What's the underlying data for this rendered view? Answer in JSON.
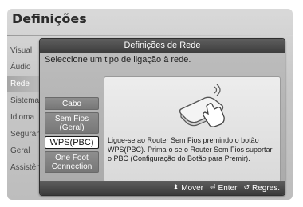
{
  "screen": {
    "title": "Definições",
    "menu": [
      "Visual",
      "Áudio",
      "Rede",
      "Sistema",
      "Idioma",
      "Segurança",
      "Geral",
      "Assistência"
    ]
  },
  "dialog": {
    "title": "Definições de Rede",
    "prompt": "Seleccione um tipo de ligação à rede.",
    "options": [
      "Cabo",
      "Sem Fios (Geral)",
      "WPS(PBC)",
      "One Foot Connection"
    ],
    "selected": "WPS(PBC)",
    "description": "Ligue-se ao Router Sem Fios premindo o botão WPS(PBC). Prima-o se o Router Sem Fios suportar o PBC (Configuração do Botão para Premir).",
    "footer": {
      "move": "Mover",
      "enter": "Enter",
      "back": "Regres."
    }
  },
  "icons": [
    "router-icon",
    "hand-pointer-icon",
    "updown-arrows-icon",
    "enter-icon",
    "return-icon"
  ]
}
